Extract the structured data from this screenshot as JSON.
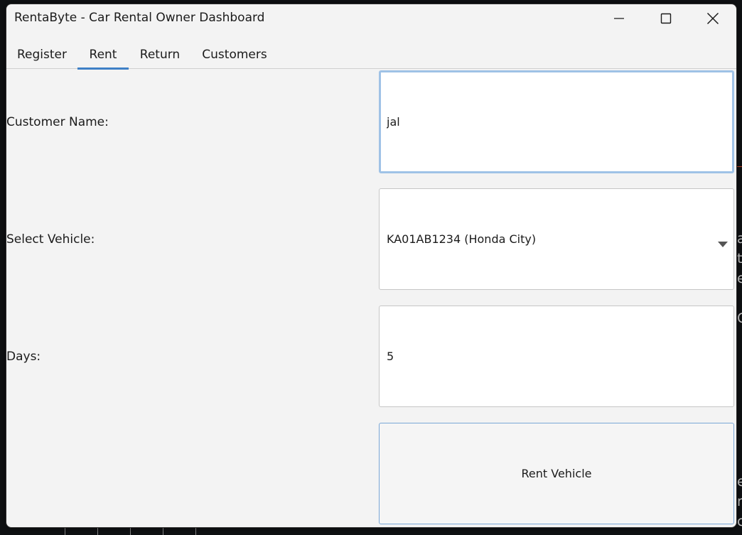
{
  "window": {
    "title": "RentaByte - Car Rental Owner Dashboard"
  },
  "tabs": [
    {
      "label": "Register",
      "active": false
    },
    {
      "label": "Rent",
      "active": true
    },
    {
      "label": "Return",
      "active": false
    },
    {
      "label": "Customers",
      "active": false
    }
  ],
  "form": {
    "customer_name_label": "Customer Name:",
    "customer_name_value": "jal",
    "vehicle_label": "Select Vehicle:",
    "vehicle_value": "KA01AB1234 (Honda City)",
    "days_label": "Days:",
    "days_value": "5",
    "submit_label": "Rent Vehicle"
  },
  "colors": {
    "accent": "#3f80c6",
    "focus_border": "#9fc2e6",
    "window_bg": "#f3f3f3"
  },
  "icons": {
    "minimize": "minimize-icon",
    "maximize": "maximize-icon",
    "close": "close-icon",
    "dropdown": "chevron-down-icon"
  }
}
